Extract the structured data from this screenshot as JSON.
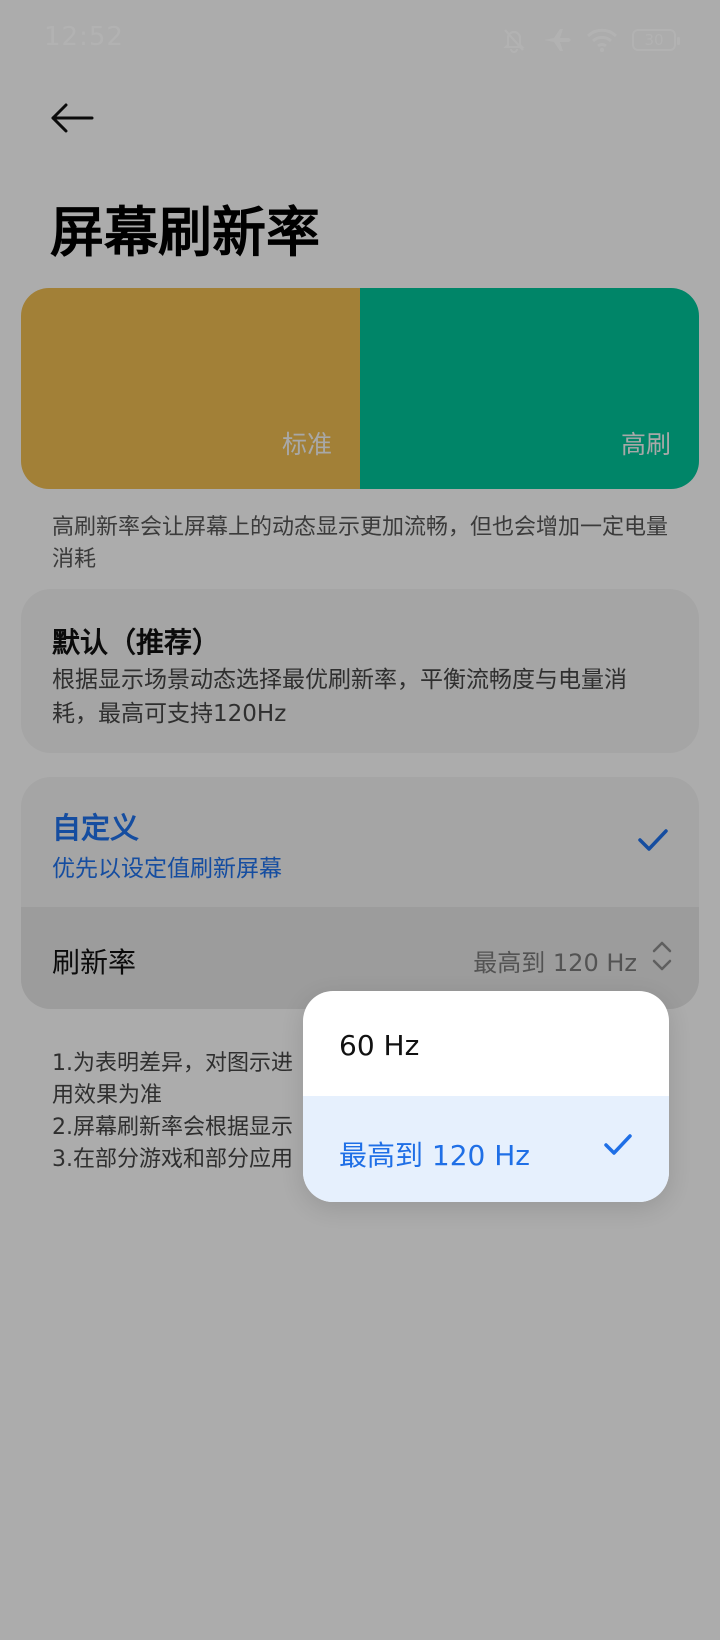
{
  "status_bar": {
    "time": "12:52",
    "icons": [
      "bell-muted-icon",
      "airplane-icon",
      "wifi-icon",
      "battery-icon"
    ],
    "battery_level": "30"
  },
  "header": {
    "back_icon": "arrow-left-icon",
    "title": "屏幕刷新率"
  },
  "preview": {
    "standard_label": "标准",
    "high_label": "高刷",
    "colors": {
      "standard": "#e8b84f",
      "high": "#00bf95"
    }
  },
  "description": "高刷新率会让屏幕上的动态显示更加流畅，但也会增加一定电量消耗",
  "options": {
    "default": {
      "title": "默认（推荐）",
      "subtitle": "根据显示场景动态选择最优刷新率，平衡流畅度与电量消耗，最高可支持120Hz",
      "selected": false
    },
    "custom": {
      "title": "自定义",
      "subtitle": "优先以设定值刷新屏幕",
      "selected": true
    }
  },
  "refresh_rate_row": {
    "label": "刷新率",
    "value": "最高到 120 Hz"
  },
  "notes": [
    "1.为表明差异，对图示进",
    "用效果为准",
    "2.屏幕刷新率会根据显示",
    "3.在部分游戏和部分应用"
  ],
  "popup_menu": {
    "items": [
      {
        "label": "60 Hz",
        "selected": false
      },
      {
        "label": "最高到 120 Hz",
        "selected": true
      }
    ]
  },
  "accent_color": "#1f6fe6"
}
